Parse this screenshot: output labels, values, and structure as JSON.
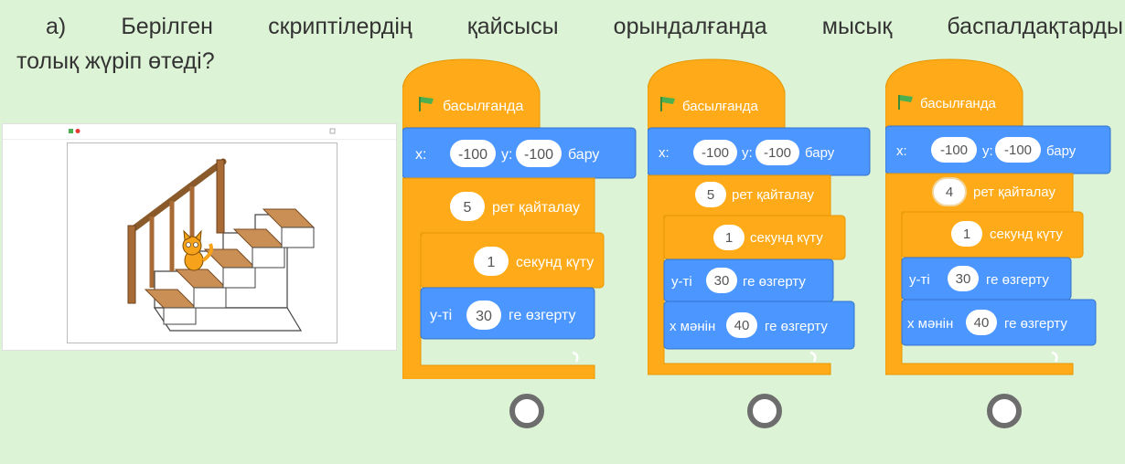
{
  "question": {
    "line1": "а) Берілген скриптілердің қайсысы орындалғанда мысық баспалдақтарды",
    "line2": "толық жүріп өтеді?"
  },
  "scripts": [
    {
      "hat": "басылғанда",
      "goto": {
        "x_label": "x:",
        "x": "-100",
        "y_label": "y:",
        "y": "-100",
        "suffix": "бару"
      },
      "repeat": {
        "count": "5",
        "label": "рет қайталау"
      },
      "wait": {
        "value": "1",
        "label": "секунд күту"
      },
      "change_y": {
        "label": "y-ті",
        "value": "30",
        "suffix": "ге өзгерту"
      }
    },
    {
      "hat": "басылғанда",
      "goto": {
        "x_label": "x:",
        "x": "-100",
        "y_label": "y:",
        "y": "-100",
        "suffix": "бару"
      },
      "repeat": {
        "count": "5",
        "label": "рет қайталау"
      },
      "wait": {
        "value": "1",
        "label": "секунд күту"
      },
      "change_y": {
        "label": "у-ті",
        "value": "30",
        "suffix": "ге өзгерту"
      },
      "change_x": {
        "label": "х мәнін",
        "value": "40",
        "suffix": "ге өзгерту"
      }
    },
    {
      "hat": "басылғанда",
      "goto": {
        "x_label": "x:",
        "x": "-100",
        "y_label": "y:",
        "y": "-100",
        "suffix": "бару"
      },
      "repeat": {
        "count": "4",
        "label": "рет қайталау"
      },
      "wait": {
        "value": "1",
        "label": "секунд күту"
      },
      "change_y": {
        "label": "у-ті",
        "value": "30",
        "suffix": "ге өзгерту"
      },
      "change_x": {
        "label": "х мәнін",
        "value": "40",
        "suffix": "ге өзгерту"
      }
    }
  ],
  "colors": {
    "background": "#ddf3d6",
    "control": "#ffab19",
    "motion": "#4c97ff",
    "events": "#ffbf00",
    "radio_border": "#6d6d6d"
  }
}
